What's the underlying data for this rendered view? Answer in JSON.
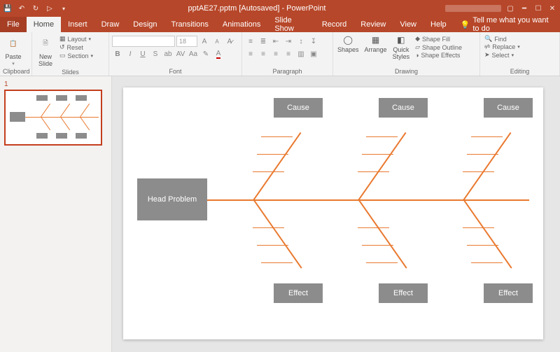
{
  "titlebar": {
    "title": "pptAE27.pptm [Autosaved] - PowerPoint"
  },
  "menu": {
    "file": "File",
    "home": "Home",
    "insert": "Insert",
    "draw": "Draw",
    "design": "Design",
    "transitions": "Transitions",
    "animations": "Animations",
    "slideshow": "Slide Show",
    "record": "Record",
    "review": "Review",
    "view": "View",
    "help": "Help",
    "tell": "Tell me what you want to do"
  },
  "ribbon": {
    "clipboard": {
      "paste": "Paste",
      "label": "Clipboard"
    },
    "slides": {
      "new": "New\nSlide",
      "layout": "Layout",
      "reset": "Reset",
      "section": "Section",
      "label": "Slides"
    },
    "font": {
      "size": "18",
      "label": "Font"
    },
    "paragraph": {
      "label": "Paragraph"
    },
    "drawing": {
      "shapes": "Shapes",
      "arrange": "Arrange",
      "quick": "Quick\nStyles",
      "shapefill": "Shape Fill",
      "shapeoutline": "Shape Outline",
      "shapeeffects": "Shape Effects",
      "label": "Drawing"
    },
    "editing": {
      "find": "Find",
      "replace": "Replace",
      "select": "Select",
      "label": "Editing"
    }
  },
  "thumb": {
    "num": "1"
  },
  "diagram": {
    "head": "Head Problem",
    "cause": "Cause",
    "effect": "Effect"
  },
  "chart_data": {
    "type": "diagram",
    "subtype": "fishbone",
    "head": "Head Problem",
    "top_branches": [
      "Cause",
      "Cause",
      "Cause"
    ],
    "bottom_branches": [
      "Effect",
      "Effect",
      "Effect"
    ],
    "sub_bones_per_branch": 3
  }
}
